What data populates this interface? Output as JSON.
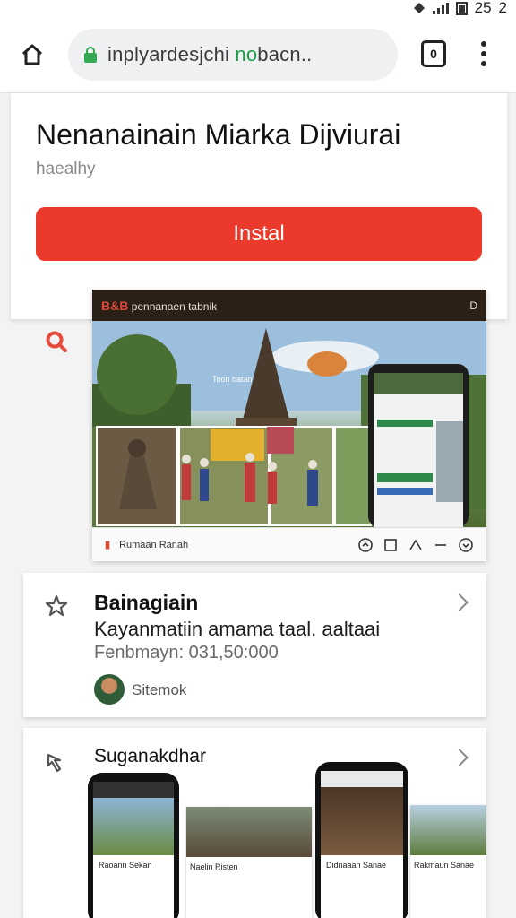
{
  "status_bar": {
    "time": "25",
    "extra": "2"
  },
  "browser": {
    "url_prefix": "inplyardesjchi ",
    "url_highlight": "no",
    "url_suffix": "bacn..",
    "tabs_count": "0"
  },
  "app": {
    "title": "Nenanainain Miarka Dijviurai",
    "subtitle": "haealhy",
    "install_label": "Instal"
  },
  "preview": {
    "brand": "B&B",
    "top_label": "pennanaen tabnik",
    "top_status": "D",
    "scene_caption": "Toon batan",
    "bottom_label": "Rumaan Ranah"
  },
  "info_card": {
    "title": "Bainagiain",
    "line": "Kayanmatiin amama taal. aaltaai",
    "meta": "Fenbmayn: 031,50:000",
    "author": "Sitemok"
  },
  "gallery": {
    "title": "Suganakdhar",
    "items": [
      {
        "caption": "Raoann Sekan"
      },
      {
        "caption": "Naelin Risten"
      },
      {
        "caption": "Didnaaan Sanae"
      },
      {
        "caption": "Rakmaun Sanae"
      }
    ]
  },
  "colors": {
    "install": "#eb3a2b",
    "secure": "#34a853",
    "accent_icon": "#e54a3a"
  }
}
